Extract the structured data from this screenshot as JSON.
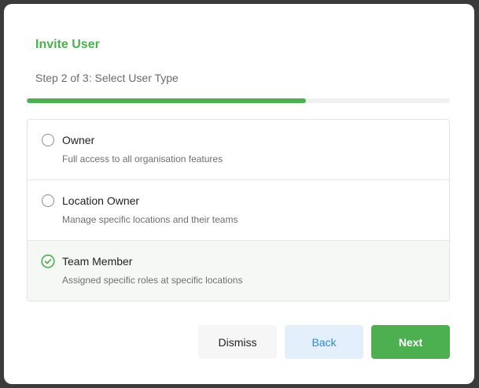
{
  "dialog": {
    "title": "Invite User",
    "step_text": "Step 2 of 3: Select User Type",
    "progress_fraction": 0.66
  },
  "options": [
    {
      "label": "Owner",
      "description": "Full access to all organisation features",
      "selected": false
    },
    {
      "label": "Location Owner",
      "description": "Manage specific locations and their teams",
      "selected": false
    },
    {
      "label": "Team Member",
      "description": "Assigned specific roles at specific locations",
      "selected": true
    }
  ],
  "buttons": {
    "dismiss": "Dismiss",
    "back": "Back",
    "next": "Next"
  },
  "colors": {
    "accent": "#4caf50",
    "link_blue": "#2f8ad4"
  }
}
